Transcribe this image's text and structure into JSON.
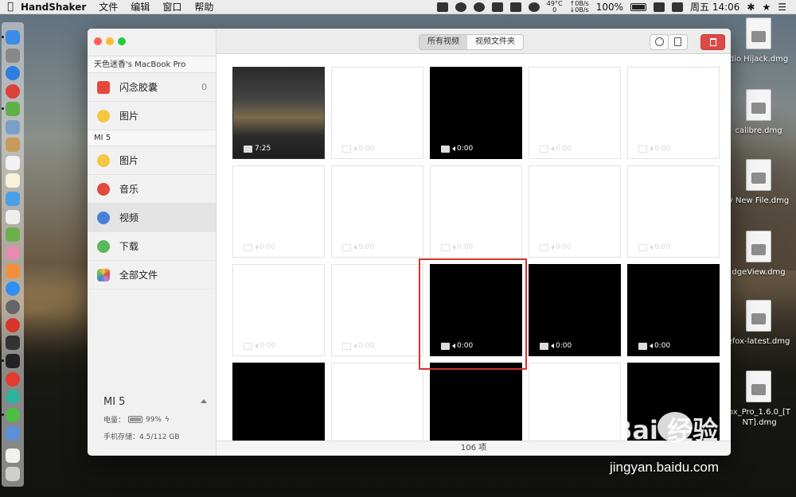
{
  "menubar": {
    "app_name": "HandShaker",
    "menus": [
      "文件",
      "编辑",
      "窗口",
      "帮助"
    ],
    "temp": "49°C",
    "temp_sub": "0",
    "net_up": "0B/s",
    "net_down": "0B/s",
    "battery": "100%",
    "clock": "周五 14:06"
  },
  "desktop_files": [
    {
      "name": "dio Hijack.dmg"
    },
    {
      "name": "calibre.dmg"
    },
    {
      "name": "y New File.dmg"
    },
    {
      "name": "dgeView.dmg"
    },
    {
      "name": "efox-latest.dmg"
    },
    {
      "name": "ox_Pro_1.6.0_[T NT].dmg"
    }
  ],
  "sidebar": {
    "computer_name": "天色迷香's MacBook Pro",
    "computer_items": [
      {
        "label": "闪念胶囊",
        "count": "0",
        "color": "#e8453c"
      },
      {
        "label": "图片",
        "color": "#f5c642"
      }
    ],
    "device_section": "MI 5",
    "device_items": [
      {
        "label": "图片",
        "color": "#f5c642"
      },
      {
        "label": "音乐",
        "color": "#e04a3f"
      },
      {
        "label": "视频",
        "color": "#4a7fd9"
      },
      {
        "label": "下载",
        "color": "#5cb85c"
      },
      {
        "label": "全部文件",
        "color": "#c080d0"
      }
    ],
    "device_info": {
      "name": "MI 5",
      "battery_label": "电量：",
      "battery_value": "99%",
      "storage": "手机存储：4.5/112 GB"
    }
  },
  "toolbar": {
    "tabs": [
      "所有视频",
      "视频文件夹"
    ]
  },
  "videos": [
    {
      "style": "clip",
      "duration": "7:25"
    },
    {
      "style": "white",
      "duration": "0:00"
    },
    {
      "style": "black",
      "duration": "0:00"
    },
    {
      "style": "white",
      "duration": "0:00"
    },
    {
      "style": "white",
      "duration": "0:00"
    },
    {
      "style": "white",
      "duration": "0:00"
    },
    {
      "style": "white",
      "duration": "0:00"
    },
    {
      "style": "white",
      "duration": "0:00"
    },
    {
      "style": "white",
      "duration": "0:00"
    },
    {
      "style": "white",
      "duration": "0:00"
    },
    {
      "style": "white",
      "duration": "0:00"
    },
    {
      "style": "white",
      "duration": "0:00"
    },
    {
      "style": "black",
      "duration": "0:00"
    },
    {
      "style": "black",
      "duration": "0:00"
    },
    {
      "style": "black",
      "duration": "0:00"
    },
    {
      "style": "black",
      "duration": ""
    },
    {
      "style": "white",
      "duration": ""
    },
    {
      "style": "black",
      "duration": ""
    },
    {
      "style": "white",
      "duration": ""
    },
    {
      "style": "black",
      "duration": ""
    }
  ],
  "status": "106 项",
  "watermark": {
    "brand": "Bai  经验",
    "site": "jingyan.baidu.com"
  }
}
